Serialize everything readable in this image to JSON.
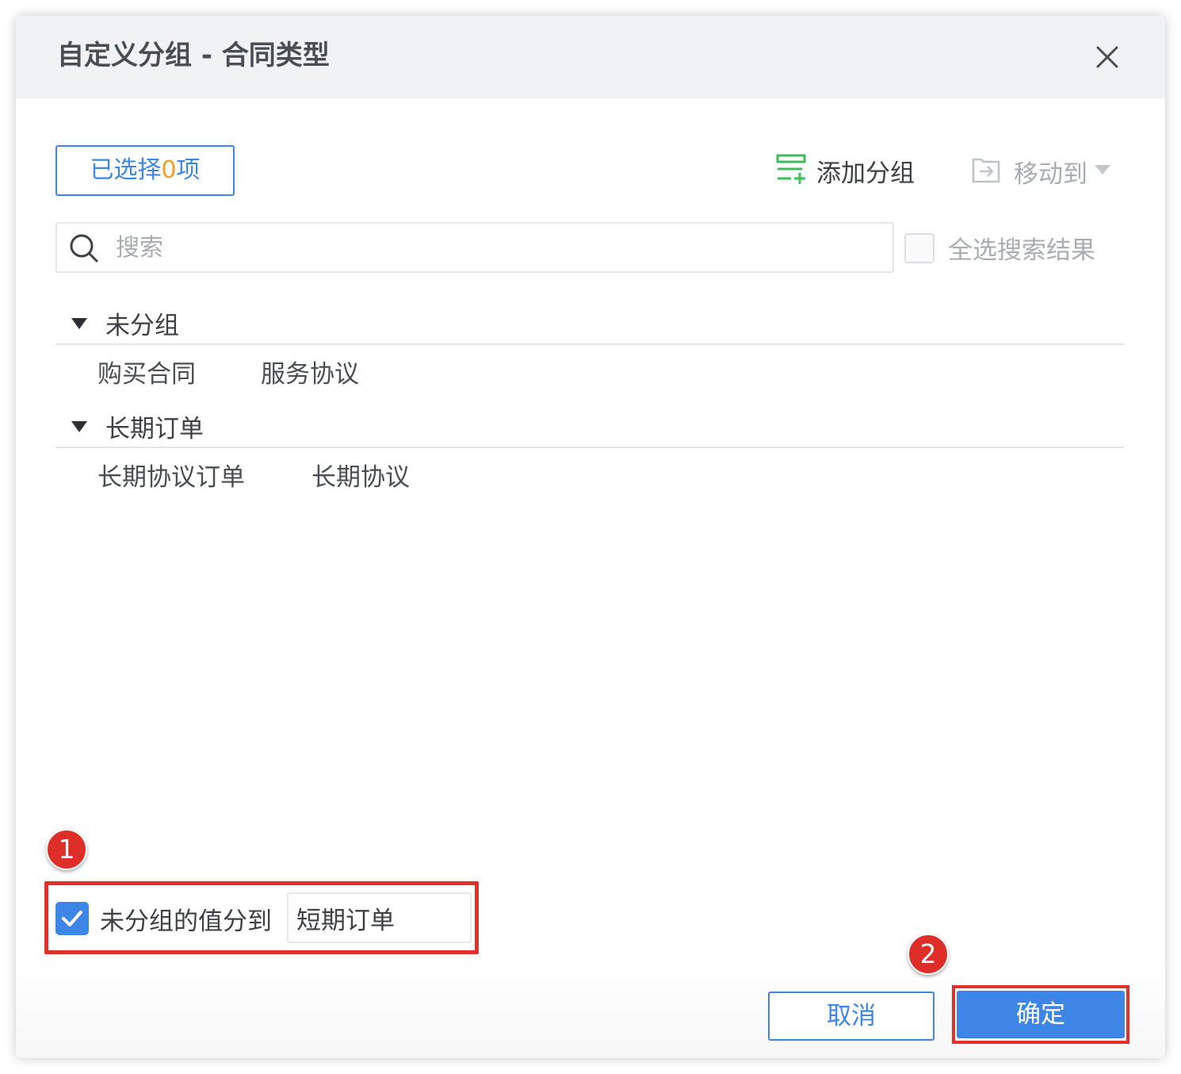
{
  "dialog": {
    "title": "自定义分组 - 合同类型",
    "close_icon": "close-icon"
  },
  "toolbar": {
    "selected_prefix": "已选择",
    "selected_count": "0",
    "selected_suffix": "项",
    "add_group_label": "添加分组",
    "add_group_icon": "add-group-icon",
    "move_to_label": "移动到",
    "move_to_icon": "move-to-icon"
  },
  "search": {
    "placeholder": "搜索",
    "value": "",
    "select_all_label": "全选搜索结果",
    "select_all_checked": false
  },
  "groups": [
    {
      "name": "未分组",
      "items": [
        "购买合同",
        "服务协议"
      ]
    },
    {
      "name": "长期订单",
      "items": [
        "长期协议订单",
        "长期协议"
      ]
    }
  ],
  "ungrouped": {
    "checked": true,
    "label": "未分组的值分到",
    "target_value": "短期订单"
  },
  "badges": [
    "1",
    "2"
  ],
  "footer": {
    "cancel_label": "取消",
    "confirm_label": "确定"
  },
  "colors": {
    "accent": "#3d86e6",
    "highlight": "#f0a121",
    "green": "#3fba5c",
    "annotation_red": "#e0312b"
  }
}
